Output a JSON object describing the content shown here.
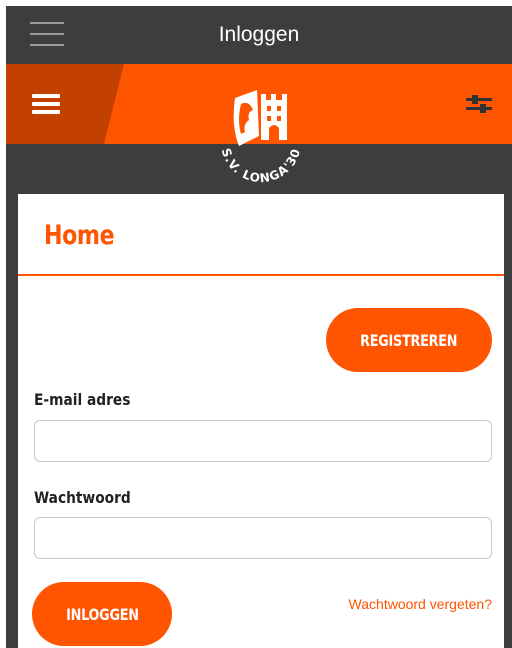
{
  "topbar": {
    "title": "Inloggen",
    "menu_icon": "hamburger-menu-icon"
  },
  "header": {
    "logo_text": "S.V. LONGA'30",
    "menu_icon": "hamburger-menu-icon",
    "filter_icon": "sliders-icon"
  },
  "page": {
    "title": "Home"
  },
  "form": {
    "register_label": "REGISTREREN",
    "email_label": "E-mail adres",
    "email_value": "",
    "password_label": "Wachtwoord",
    "password_value": "",
    "login_label": "INLOGGEN",
    "forgot_label": "Wachtwoord vergeten?"
  },
  "colors": {
    "accent": "#ff5400",
    "accent_dark": "#c24000",
    "dark_bg": "#3d3d3d"
  }
}
